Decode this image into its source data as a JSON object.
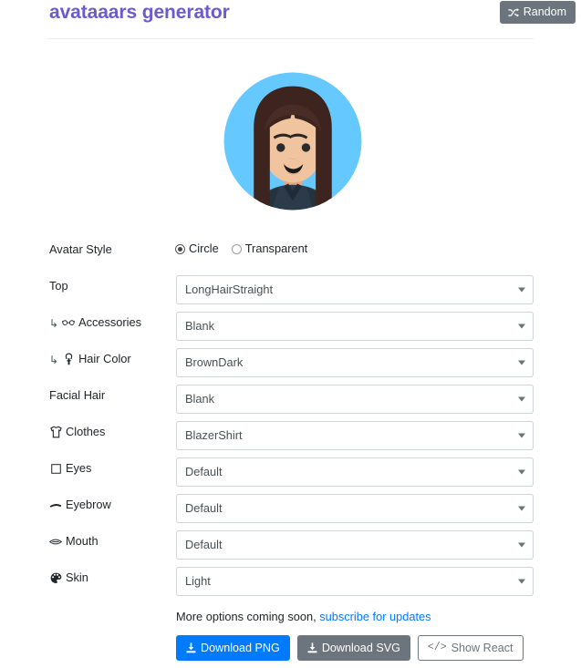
{
  "header": {
    "title": "avataaars generator",
    "random_button": {
      "label": "Random",
      "icon": "shuffle-icon"
    }
  },
  "avatar": {
    "style": "Circle",
    "background_color": "#65c9ff",
    "skin_color": "#f1c4a0",
    "hair_color": "#3d241f",
    "clothes_color": "#2b3b4a",
    "mouth_color": "#1d1a1a",
    "eye_color": "#2c2c2c"
  },
  "form": {
    "avatar_style": {
      "label": "Avatar Style",
      "options": [
        "Circle",
        "Transparent"
      ],
      "selected": "Circle"
    },
    "fields": [
      {
        "label": "Top",
        "icon": null,
        "sub": false,
        "value": "LongHairStraight"
      },
      {
        "label": "Accessories",
        "icon": "glasses-icon",
        "sub": true,
        "value": "Blank"
      },
      {
        "label": "Hair Color",
        "icon": "hair-color-icon",
        "sub": true,
        "value": "BrownDark"
      },
      {
        "label": "Facial Hair",
        "icon": null,
        "sub": false,
        "value": "Blank"
      },
      {
        "label": "Clothes",
        "icon": "tshirt-icon",
        "sub": false,
        "value": "BlazerShirt"
      },
      {
        "label": "Eyes",
        "icon": "eye-square-icon",
        "sub": false,
        "value": "Default"
      },
      {
        "label": "Eyebrow",
        "icon": "eyebrow-icon",
        "sub": false,
        "value": "Default"
      },
      {
        "label": "Mouth",
        "icon": "mouth-icon",
        "sub": false,
        "value": "Default"
      },
      {
        "label": "Skin",
        "icon": "palette-icon",
        "sub": false,
        "value": "Light"
      }
    ]
  },
  "footer": {
    "note_text": "More options coming soon, ",
    "note_link": "subscribe for updates",
    "buttons": [
      {
        "label": "Download PNG",
        "icon": "download-icon",
        "variant": "primary"
      },
      {
        "label": "Download SVG",
        "icon": "download-icon",
        "variant": "secondary"
      },
      {
        "label": "Show React",
        "icon": "code-icon",
        "variant": "outline"
      }
    ]
  },
  "colors": {
    "title": "#6b5ccd",
    "primary": "#007bff",
    "secondary": "#6c757d",
    "link": "#007bff"
  }
}
